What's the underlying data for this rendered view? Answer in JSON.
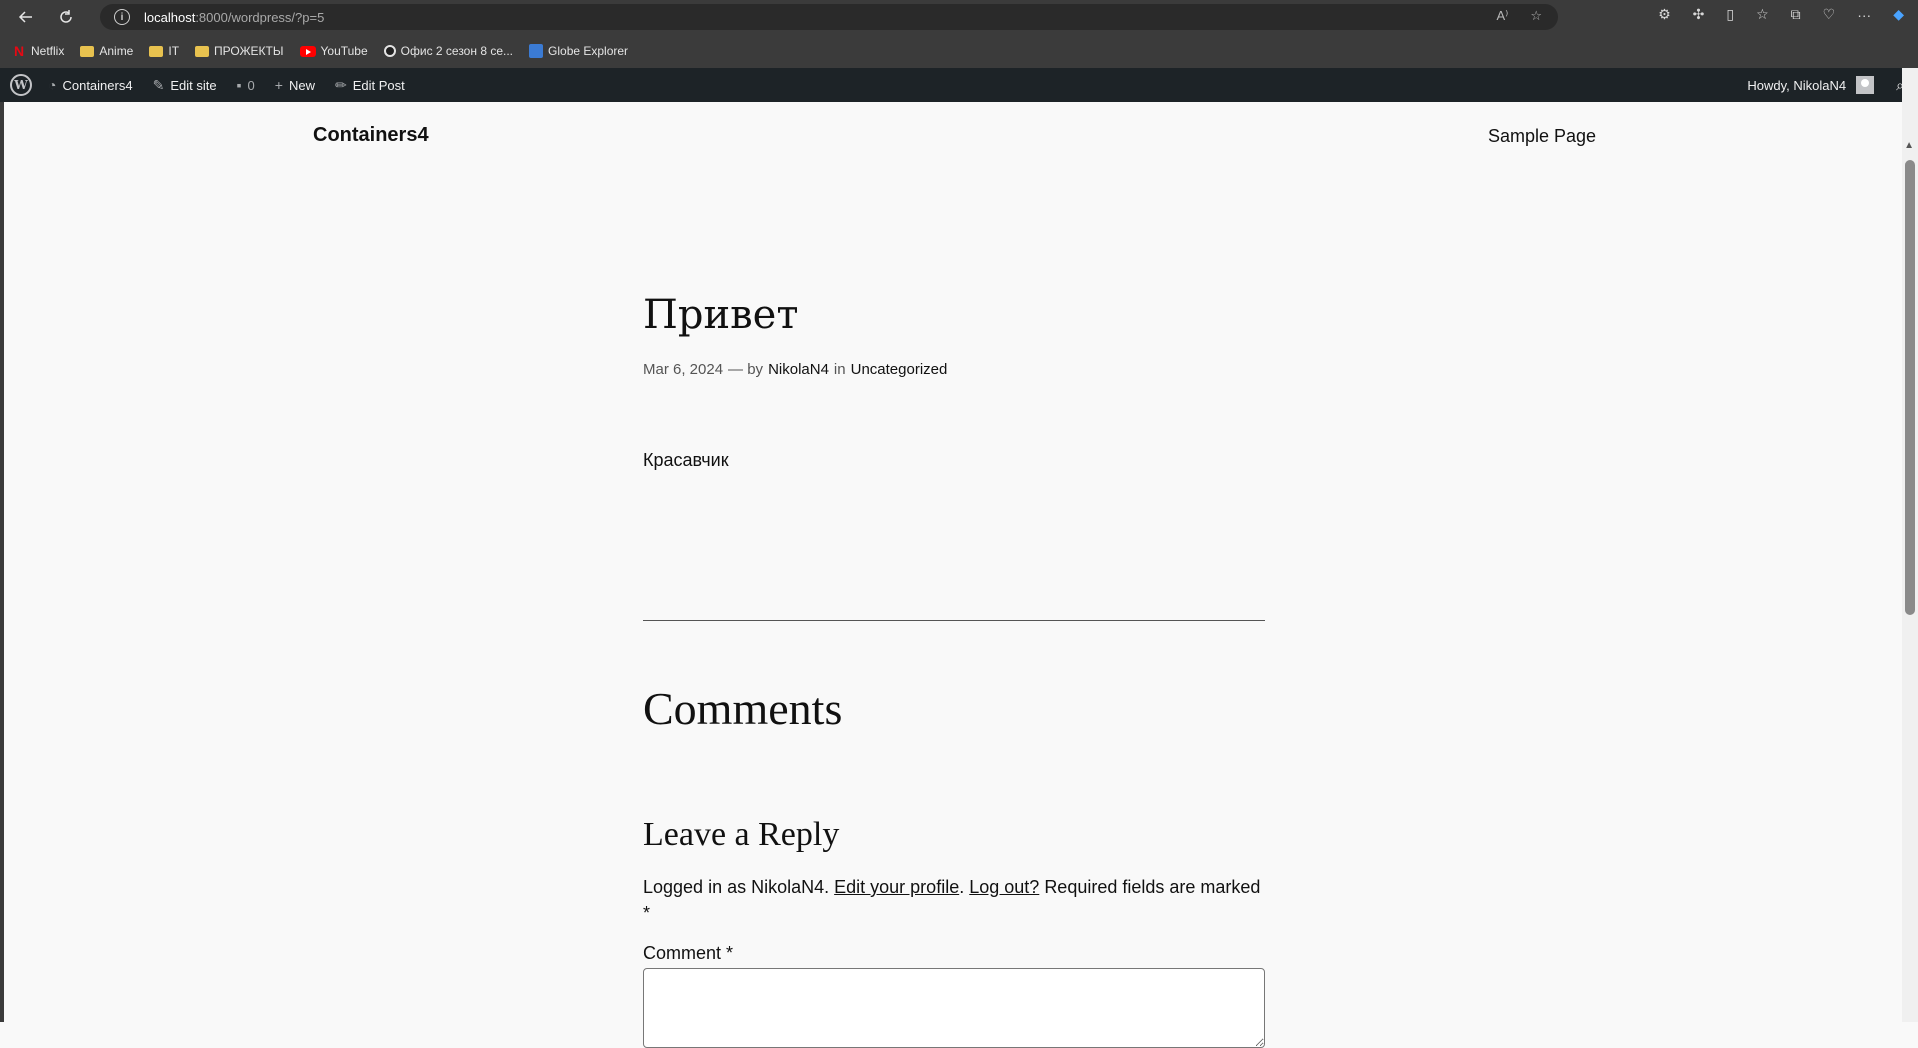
{
  "browser": {
    "url_host": "localhost",
    "url_path": ":8000/wordpress/?p=5",
    "bookmarks": [
      {
        "label": "Netflix",
        "icon": "netflix-icon"
      },
      {
        "label": "Anime",
        "icon": "folder-icon"
      },
      {
        "label": "IT",
        "icon": "folder-icon"
      },
      {
        "label": "ПРОЖЕКТЫ",
        "icon": "folder-icon"
      },
      {
        "label": "YouTube",
        "icon": "youtube-icon"
      },
      {
        "label": "Офис 2 сезон 8 се...",
        "icon": "office-icon"
      },
      {
        "label": "Globe Explorer",
        "icon": "globe-icon"
      }
    ]
  },
  "admin_bar": {
    "site_name": "Containers4",
    "edit_site": "Edit site",
    "comments_count": "0",
    "new_label": "New",
    "edit_post": "Edit Post",
    "howdy": "Howdy, NikolaN4"
  },
  "site": {
    "title": "Containers4",
    "nav_sample_page": "Sample Page"
  },
  "post": {
    "title": "Привет",
    "date": "Mar 6, 2024",
    "by": "— by",
    "author": "NikolaN4",
    "in": "in",
    "category": "Uncategorized",
    "content": "Красавчик"
  },
  "comments": {
    "heading": "Comments",
    "reply_heading": "Leave a Reply",
    "logged_in_prefix": "Logged in as NikolaN4.",
    "edit_profile": "Edit your profile",
    "logout": "Log out?",
    "required_note": "Required fields are marked",
    "required_star": "*",
    "comment_label": "Comment *"
  }
}
